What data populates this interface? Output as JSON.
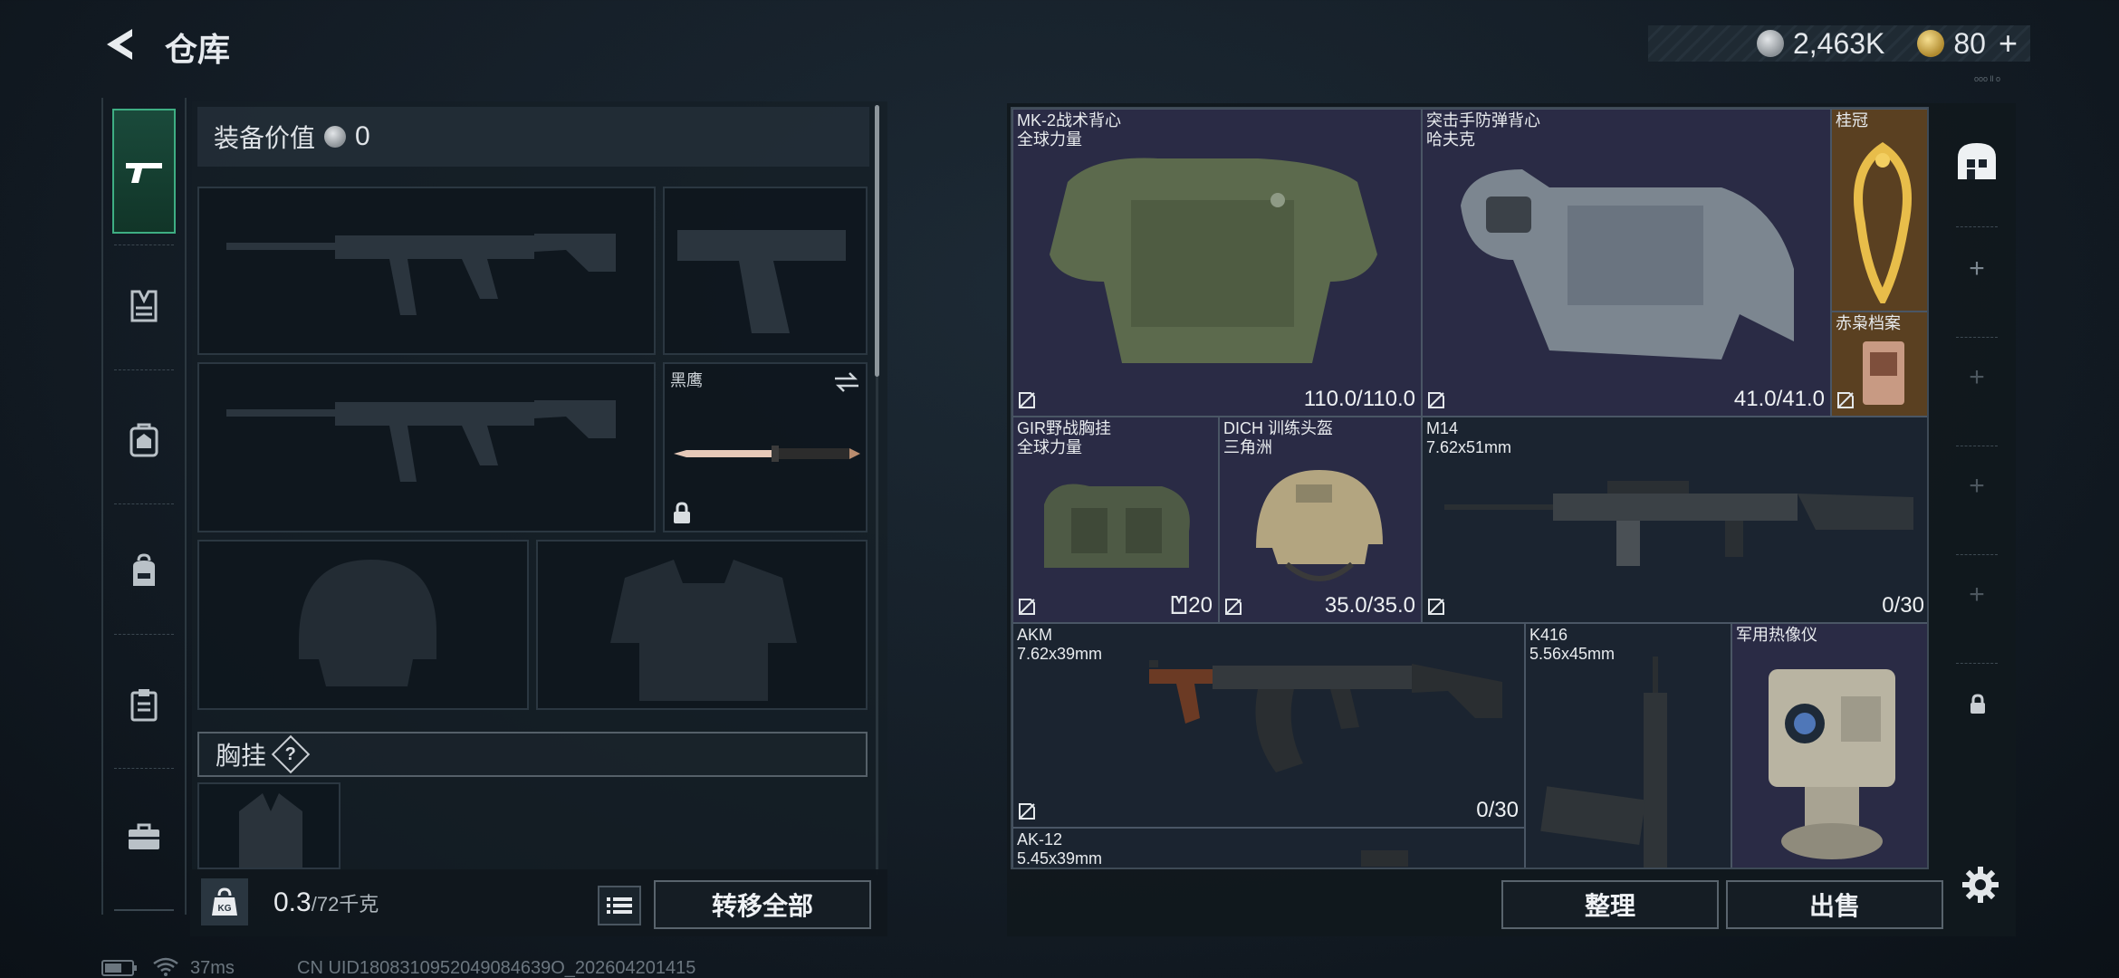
{
  "header": {
    "title": "仓库",
    "silver_amount": "2,463K",
    "gold_amount": "80",
    "gold_plus": "+",
    "version_tag": "ooo ll o"
  },
  "sidebar": {
    "tabs": [
      {
        "icon": "pistol-icon",
        "active": true
      },
      {
        "icon": "chest-rig-icon"
      },
      {
        "icon": "backpack-armor-icon"
      },
      {
        "icon": "backpack-icon"
      },
      {
        "icon": "clipboard-icon"
      },
      {
        "icon": "toolbox-icon"
      }
    ]
  },
  "equipment": {
    "value_label": "装备价值",
    "value": "0",
    "melee_label": "黑鹰",
    "chest_rig_label": "胸挂",
    "help_mark": "?",
    "weight_current": "0.3",
    "weight_max": "/72千克",
    "weight_icon_text": "KG",
    "transfer_all": "转移全部"
  },
  "stash": {
    "items": [
      {
        "name": "MK-2战术背心",
        "sub": "全球力量",
        "durability": "110.0/110.0",
        "rarity": "purple"
      },
      {
        "name": "突击手防弹背心",
        "sub": "哈夫克",
        "durability": "41.0/41.0",
        "rarity": "purple"
      },
      {
        "name": "桂冠",
        "sub": "",
        "durability": "",
        "rarity": "gold"
      },
      {
        "name": "赤枭档案",
        "sub": "",
        "durability": "",
        "rarity": "gold"
      },
      {
        "name": "GIR野战胸挂",
        "sub": "全球力量",
        "durability": "20",
        "rarity": "purple"
      },
      {
        "name": "DICH 训练头盔",
        "sub": "三角洲",
        "durability": "35.0/35.0",
        "rarity": "purple"
      },
      {
        "name": "M14",
        "sub": "7.62x51mm",
        "durability": "0/30",
        "rarity": "dark"
      },
      {
        "name": "AKM",
        "sub": "7.62x39mm",
        "durability": "0/30",
        "rarity": "dark"
      },
      {
        "name": "K416",
        "sub": "5.56x45mm",
        "durability": "",
        "rarity": "dark"
      },
      {
        "name": "军用热像仪",
        "sub": "",
        "durability": "",
        "rarity": "purple"
      },
      {
        "name": "AK-12",
        "sub": "5.45x39mm",
        "durability": "",
        "rarity": "dark"
      }
    ],
    "sort_button": "整理",
    "sell_button": "出售"
  },
  "status_bar": {
    "ping": "37ms",
    "uid": "CN UID1808310952049084639O_202604201415"
  },
  "colors": {
    "accent_green": "#3eae83",
    "rarity_purple": "#2a2b45",
    "rarity_gold": "#5a4021"
  }
}
